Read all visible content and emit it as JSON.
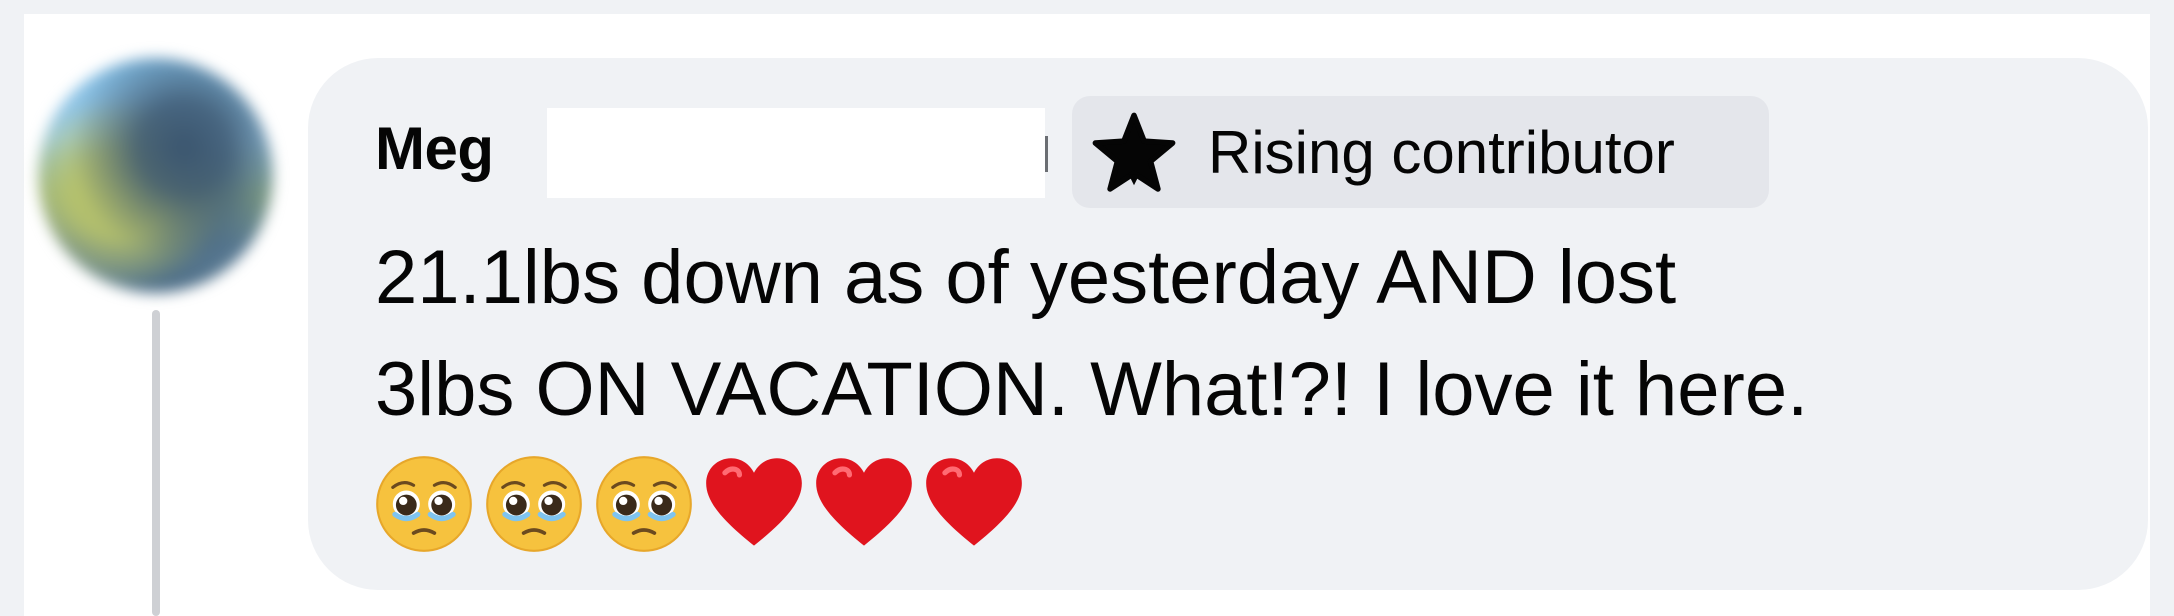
{
  "comment": {
    "author_visible": "Meg",
    "badge": {
      "label": "Rising contributor",
      "icon": "star-icon"
    },
    "text_line_1": "21.1lbs down as of yesterday AND lost",
    "text_line_2": "3lbs ON VACATION. What!?! I love it here.",
    "emojis": [
      "pleading-face",
      "pleading-face",
      "pleading-face",
      "red-heart",
      "red-heart",
      "red-heart"
    ]
  },
  "colors": {
    "bubble_background": "#f0f2f5",
    "badge_background": "#e4e6eb",
    "text": "#050505",
    "heart": "#e0141e",
    "thread_line": "#ced0d4"
  }
}
